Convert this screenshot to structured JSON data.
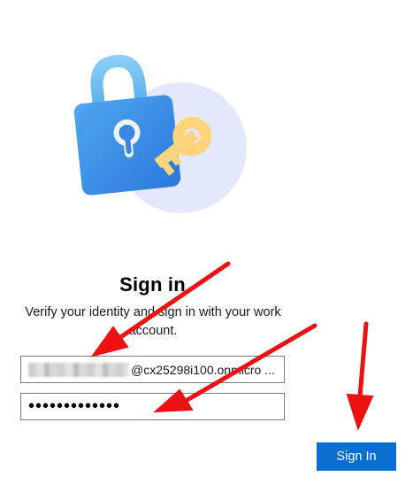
{
  "signin": {
    "title": "Sign in",
    "subtitle": "Verify your identity and sign in with your work account.",
    "username_value": "@cx25298i100.onmicro ...",
    "password_value": "•••••••••••••",
    "button_label": "Sign In"
  },
  "colors": {
    "primary": "#0a6fd1",
    "lock_blue": "#3a90e6",
    "key_yellow": "#ffd47a",
    "circle_bg": "#e4e8fb",
    "arrow_red": "#ee1111"
  },
  "icons": {
    "hero": "lock-and-key-icon",
    "annotations": "red-arrow-icon"
  }
}
